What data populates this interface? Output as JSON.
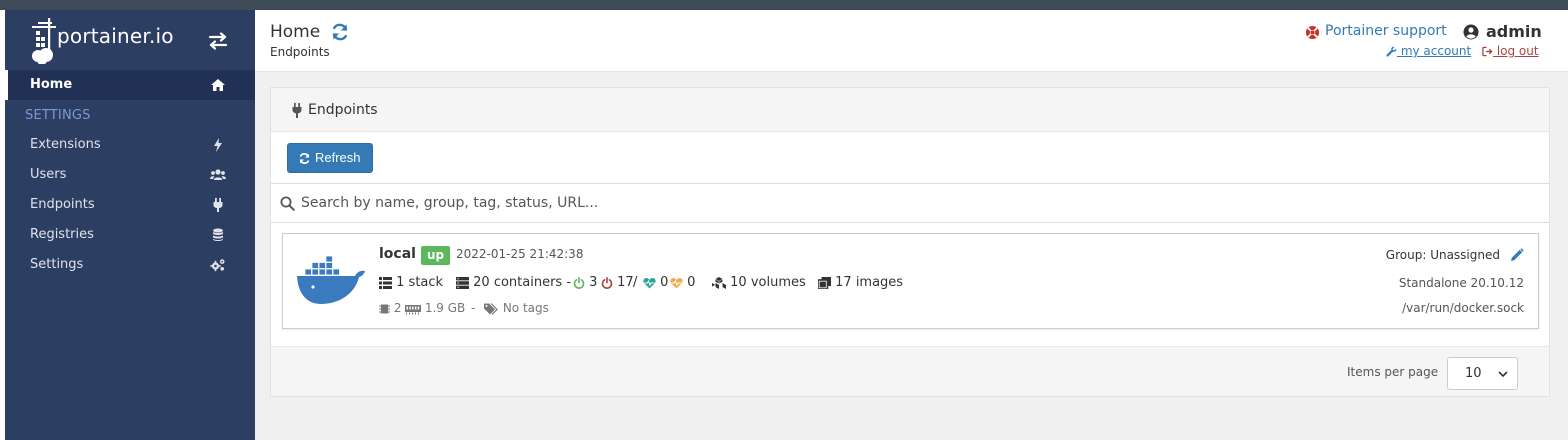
{
  "app": {
    "logo_text": "portainer.io"
  },
  "sidebar": {
    "home": {
      "label": "Home",
      "icon": "home-icon"
    },
    "section_label": "SETTINGS",
    "items": [
      {
        "label": "Extensions",
        "icon": "bolt-icon"
      },
      {
        "label": "Users",
        "icon": "users-icon"
      },
      {
        "label": "Endpoints",
        "icon": "plug-icon"
      },
      {
        "label": "Registries",
        "icon": "database-icon"
      },
      {
        "label": "Settings",
        "icon": "cogs-icon"
      }
    ]
  },
  "header": {
    "title": "Home",
    "breadcrumb": "Endpoints",
    "support_label": "Portainer support",
    "username": "admin",
    "my_account": " my account ",
    "log_out": " log out"
  },
  "panel": {
    "title": "Endpoints",
    "refresh_label": "Refresh",
    "search_placeholder": "Search by name, group, tag, status, URL..."
  },
  "endpoint": {
    "name": "local",
    "status": "up",
    "timestamp": "2022-01-25 21:42:38",
    "stacks": "1 stack",
    "containers": "20 containers -",
    "running": "3",
    "stopped": "17",
    "separator": "/",
    "healthy": "0",
    "unhealthy": "0",
    "volumes": "10 volumes",
    "images": "17 images",
    "cpu": "2",
    "memory": "1.9 GB",
    "dash": "-",
    "tags": "No tags",
    "group": "Group: Unassigned",
    "version": "Standalone 20.10.12",
    "url": "/var/run/docker.sock"
  },
  "pagination": {
    "label": "Items per page",
    "value": "10"
  },
  "colors": {
    "sidebar_bg": "#2d3e63",
    "accent": "#337ab7",
    "status_up": "#5cb85c",
    "danger": "#a94442",
    "running": "#5cb85c",
    "stopped": "#a94442",
    "healthy": "#29a798",
    "unhealthy": "#f0ad4e"
  }
}
